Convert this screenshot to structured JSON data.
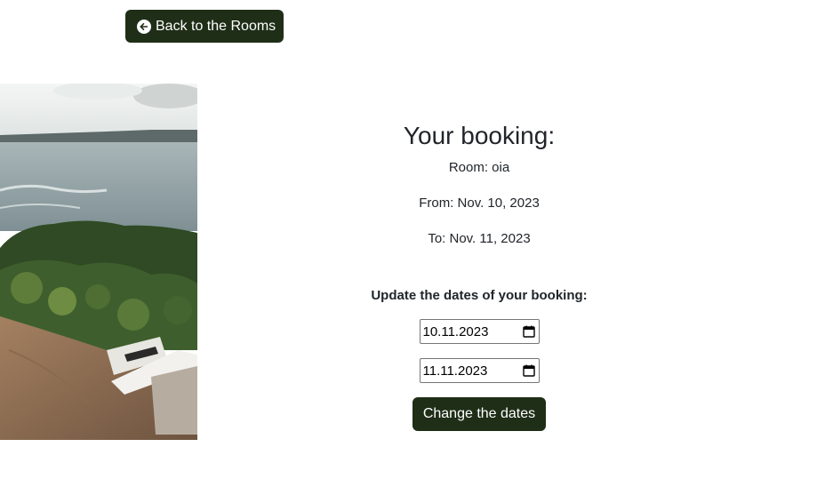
{
  "nav": {
    "back_label": "Back to the Rooms",
    "back_icon": "arrow-left-circle-icon"
  },
  "booking": {
    "title": "Your booking:",
    "room": "Room: oia",
    "from": "From: Nov. 10, 2023",
    "to": "To: Nov. 11, 2023"
  },
  "update": {
    "title": "Update the dates of your booking:",
    "start_date": "10.11.2023",
    "end_date": "11.11.2023",
    "submit_label": "Change the dates"
  },
  "colors": {
    "button_bg": "#1f2e17",
    "button_text": "#ffffff",
    "text": "#212529"
  }
}
